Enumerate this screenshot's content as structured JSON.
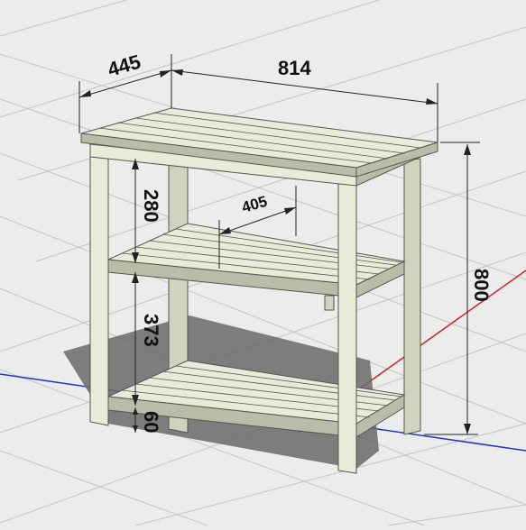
{
  "dimensions": {
    "depth": "445",
    "width": "814",
    "height": "800",
    "shelf_gap_upper": "280",
    "shelf_depth": "405",
    "shelf_gap_lower": "373",
    "bottom_clearance": "60"
  },
  "colors": {
    "background": "#ececec",
    "grid": "#c4c4c4",
    "axis_red": "#d22020",
    "axis_blue": "#2233cc",
    "wood_light": "#e9ebd9",
    "slat_gray": "#8f8f8f",
    "shadow": "#6a6a6a"
  }
}
